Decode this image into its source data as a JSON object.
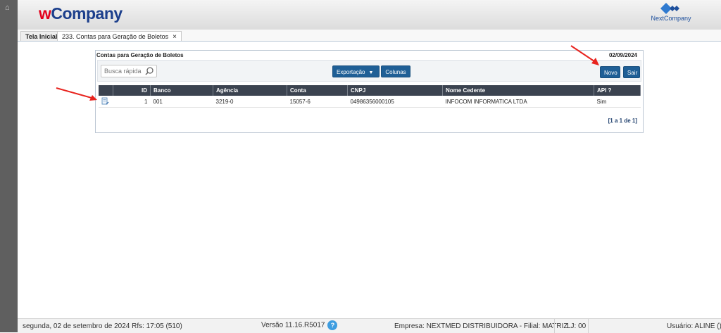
{
  "header": {
    "logo_prefix": "w",
    "logo_suffix": "Company",
    "partner_logo_text": "NextCompany"
  },
  "tabs": [
    {
      "label": "Tela Inicial"
    },
    {
      "label": "233. Contas para Geração de Boletos",
      "close": "×"
    }
  ],
  "panel": {
    "title": "Contas para Geração de Boletos",
    "date": "02/09/2024"
  },
  "toolbar": {
    "search_placeholder": "Busca rápida",
    "export_label": "Exportação",
    "columns_label": "Colunas",
    "new_label": "Novo",
    "exit_label": "Sair"
  },
  "grid": {
    "columns": [
      "ID",
      "Banco",
      "Agência",
      "Conta",
      "CNPJ",
      "Nome Cedente",
      "API ?"
    ],
    "rows": [
      [
        "1",
        "001",
        "3219-0",
        "15057-6",
        "04986356000105",
        "INFOCOM INFORMATICA LTDA",
        "Sim"
      ]
    ],
    "row_icon": "edit-document-icon"
  },
  "pager": "[1 a 1 de 1]",
  "status": {
    "datetime": "segunda, 02 de setembro de 2024  Rfs: 17:05 (510)",
    "version": "Versão 11.16.R5017",
    "help": "?",
    "company": "Empresa: NEXTMED DISTRIBUIDORA - Filial: MATRIZ",
    "store": "LJ: 00",
    "user": "Usuário: ALINE ()"
  },
  "colors": {
    "brand_red": "#e3001b",
    "brand_blue": "#1c3f8c",
    "button_blue": "#1f5f96",
    "grid_header": "#3b4350",
    "annotation_arrow": "#e8231e"
  }
}
